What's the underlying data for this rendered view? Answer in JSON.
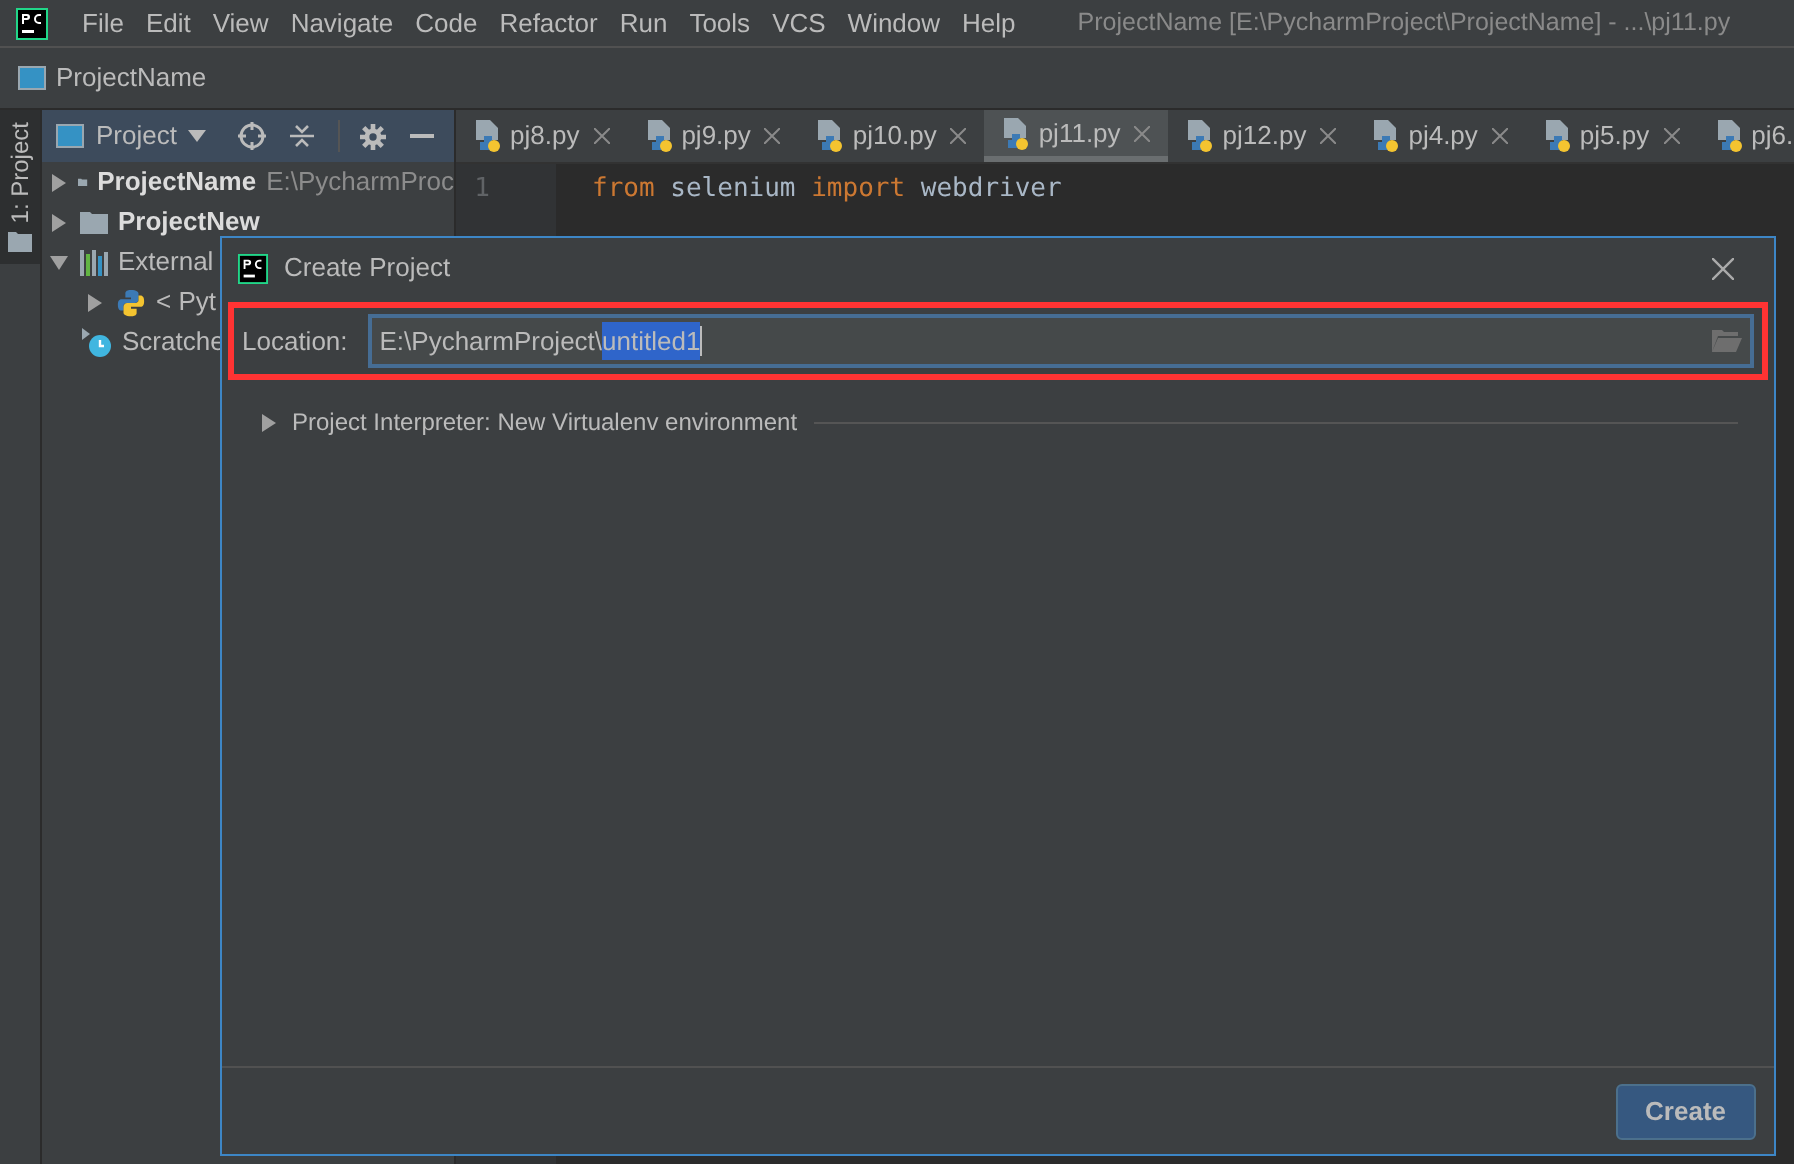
{
  "window": {
    "title": "ProjectName [E:\\PycharmProject\\ProjectName] - ...\\pj11.py"
  },
  "menu": [
    "File",
    "Edit",
    "View",
    "Navigate",
    "Code",
    "Refactor",
    "Run",
    "Tools",
    "VCS",
    "Window",
    "Help"
  ],
  "nav_bar": {
    "label": "ProjectName"
  },
  "side_strip": {
    "label": "1: Project",
    "selected": true
  },
  "project_panel": {
    "title": "Project",
    "tree": [
      {
        "kind": "folder",
        "name": "ProjectName",
        "path": "E:\\PycharmProc",
        "expanded": false
      },
      {
        "kind": "folder",
        "name": "ProjectNew",
        "expanded": false
      },
      {
        "kind": "library",
        "name": "External",
        "expanded": true,
        "children": [
          {
            "kind": "python",
            "name": "< Pyt",
            "expanded": false
          }
        ]
      },
      {
        "kind": "scratch",
        "name": "Scratche"
      }
    ]
  },
  "editor_tabs": [
    {
      "label": "pj8.py",
      "selected": false
    },
    {
      "label": "pj9.py",
      "selected": false
    },
    {
      "label": "pj10.py",
      "selected": false
    },
    {
      "label": "pj11.py",
      "selected": true
    },
    {
      "label": "pj12.py",
      "selected": false
    },
    {
      "label": "pj4.py",
      "selected": false
    },
    {
      "label": "pj5.py",
      "selected": false
    },
    {
      "label": "pj6.",
      "selected": false
    }
  ],
  "editor": {
    "lines": [
      {
        "number": "1",
        "tokens": [
          {
            "kind": "keyword",
            "text": "from"
          },
          {
            "kind": "plain",
            "text": "selenium"
          },
          {
            "kind": "keyword",
            "text": "import"
          },
          {
            "kind": "plain",
            "text": "webdriver"
          }
        ]
      }
    ]
  },
  "dialog": {
    "title": "Create Project",
    "location": {
      "label": "Location:",
      "value": "E:\\PycharmProject\\",
      "selected_text": "untitled1",
      "highlighted": true
    },
    "interpreter": {
      "label": "Project Interpreter: New Virtualenv environment",
      "expanded": false
    },
    "buttons": [
      "Create"
    ]
  }
}
